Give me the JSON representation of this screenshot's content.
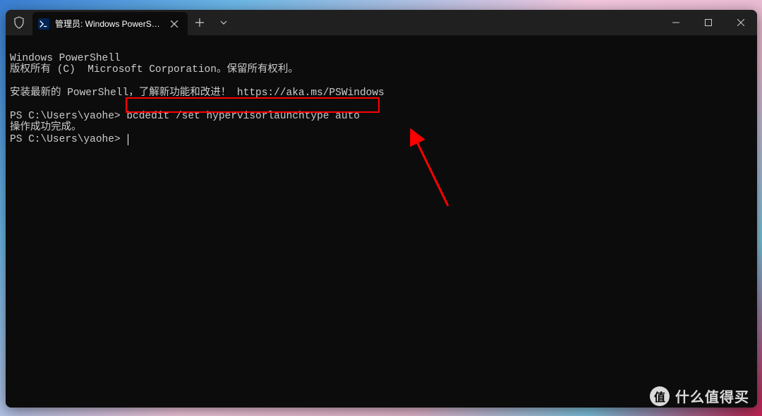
{
  "tab": {
    "title": "管理员: Windows PowerShell"
  },
  "terminal": {
    "line1": "Windows PowerShell",
    "line2": "版权所有 (C)  Microsoft Corporation。保留所有权利。",
    "line3": "安装最新的 PowerShell，了解新功能和改进！ https://aka.ms/PSWindows",
    "prompt1_prefix": "PS C:\\Users\\yaohe> ",
    "prompt1_command": "bcdedit /set hypervisorlaunchtype auto",
    "result": "操作成功完成。",
    "prompt2": "PS C:\\Users\\yaohe>"
  },
  "watermark": {
    "badge": "值",
    "text": "什么值得买"
  }
}
